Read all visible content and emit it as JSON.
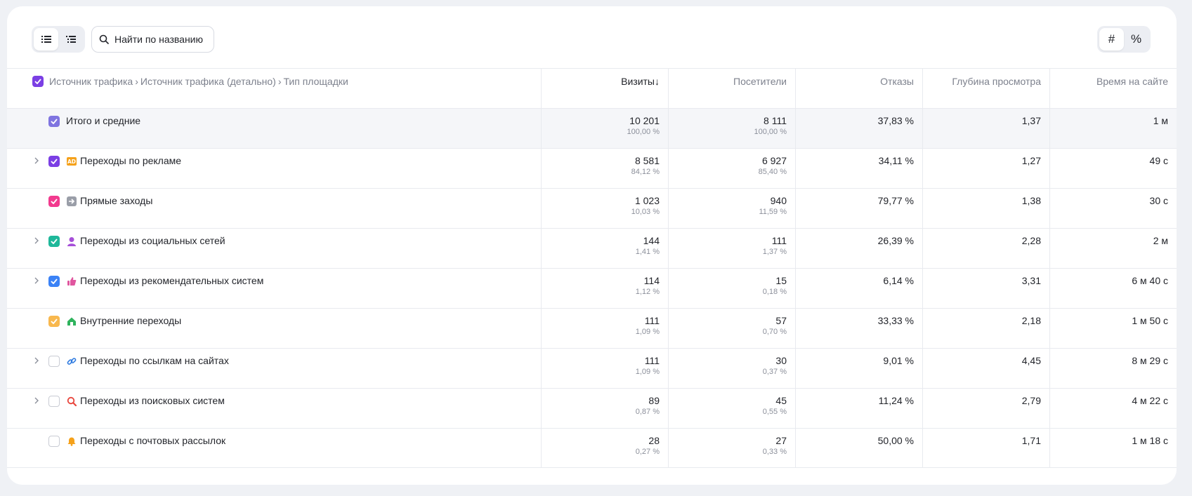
{
  "toolbar": {
    "search_placeholder": "Найти по названию",
    "unit_count_symbol": "#",
    "unit_percent_symbol": "%"
  },
  "header": {
    "breadcrumb": [
      "Источник трафика",
      "Источник трафика (детально)",
      "Тип площадки"
    ],
    "columns": [
      "Визиты",
      "Посетители",
      "Отказы",
      "Глубина просмотра",
      "Время на сайте"
    ],
    "sort_arrow": "↓"
  },
  "rows": [
    {
      "label": "Итого и средние",
      "visits": "10 201",
      "visits_pct": "100,00 %",
      "visitors": "8 111",
      "visitors_pct": "100,00 %",
      "bounce": "37,83 %",
      "depth": "1,37",
      "time": "1 м"
    },
    {
      "label": "Переходы по рекламе",
      "visits": "8 581",
      "visits_pct": "84,12 %",
      "visitors": "6 927",
      "visitors_pct": "85,40 %",
      "bounce": "34,11 %",
      "depth": "1,27",
      "time": "49 с"
    },
    {
      "label": "Прямые заходы",
      "visits": "1 023",
      "visits_pct": "10,03 %",
      "visitors": "940",
      "visitors_pct": "11,59 %",
      "bounce": "79,77 %",
      "depth": "1,38",
      "time": "30 с"
    },
    {
      "label": "Переходы из социальных сетей",
      "visits": "144",
      "visits_pct": "1,41 %",
      "visitors": "111",
      "visitors_pct": "1,37 %",
      "bounce": "26,39 %",
      "depth": "2,28",
      "time": "2 м"
    },
    {
      "label": "Переходы из рекомендательных систем",
      "visits": "114",
      "visits_pct": "1,12 %",
      "visitors": "15",
      "visitors_pct": "0,18 %",
      "bounce": "6,14 %",
      "depth": "3,31",
      "time": "6 м 40 с"
    },
    {
      "label": "Внутренние переходы",
      "visits": "111",
      "visits_pct": "1,09 %",
      "visitors": "57",
      "visitors_pct": "0,70 %",
      "bounce": "33,33 %",
      "depth": "2,18",
      "time": "1 м 50 с"
    },
    {
      "label": "Переходы по ссылкам на сайтах",
      "visits": "111",
      "visits_pct": "1,09 %",
      "visitors": "30",
      "visitors_pct": "0,37 %",
      "bounce": "9,01 %",
      "depth": "4,45",
      "time": "8 м 29 с"
    },
    {
      "label": "Переходы из поисковых систем",
      "visits": "89",
      "visits_pct": "0,87 %",
      "visitors": "45",
      "visitors_pct": "0,55 %",
      "bounce": "11,24 %",
      "depth": "2,79",
      "time": "4 м 22 с"
    },
    {
      "label": "Переходы с почтовых рассылок",
      "visits": "28",
      "visits_pct": "0,27 %",
      "visitors": "27",
      "visitors_pct": "0,33 %",
      "bounce": "50,00 %",
      "depth": "1,71",
      "time": "1 м 18 с"
    }
  ],
  "colors": {
    "header_checkbox": "#7b3fe4",
    "total_checkbox": "#7f74e0",
    "ads": "#7b3fe4",
    "direct": "#f23a8e",
    "social": "#1fb89a",
    "recommend": "#3b82f6",
    "internal": "#f8b84e"
  },
  "icons": {
    "ads": "ad-badge-icon",
    "direct": "enter-arrow-icon",
    "social": "person-icon",
    "recommend": "thumbs-up-icon",
    "internal": "house-icon",
    "links": "link-icon",
    "search": "magnifier-icon",
    "email": "bell-icon"
  }
}
